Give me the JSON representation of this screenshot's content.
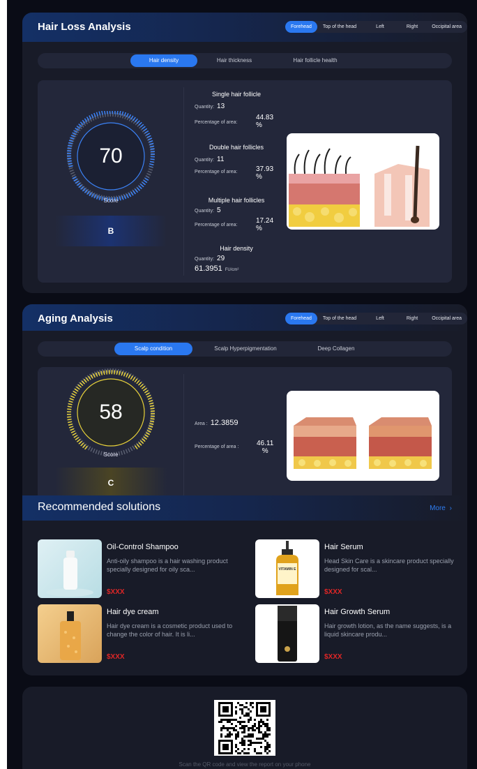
{
  "regions": [
    "Forehead",
    "Top of the head",
    "Left",
    "Right",
    "Occipital area"
  ],
  "hair_loss": {
    "title": "Hair Loss Analysis",
    "tabs": [
      "Hair density",
      "Hair thickness",
      "Hair follicle health"
    ],
    "score": "70",
    "score_label": "Score",
    "grade": "B",
    "quantity_label": "Quantity:",
    "percentage_label": "Percentage of area:",
    "single": {
      "title": "Single hair follicle",
      "quantity": "13",
      "percentage": "44.83",
      "unit": "%"
    },
    "double": {
      "title": "Double hair follicles",
      "quantity": "11",
      "percentage": "37.93",
      "unit": "%"
    },
    "multiple": {
      "title": "Multiple hair follicles",
      "quantity": "5",
      "percentage": "17.24",
      "unit": "%"
    },
    "density": {
      "title": "Hair density",
      "quantity": "29",
      "value": "61.3951",
      "unit": "FU/cm²"
    }
  },
  "aging": {
    "title": "Aging Analysis",
    "tabs": [
      "Scalp condition",
      "Scalp Hyperpigmentation",
      "Deep Collagen"
    ],
    "score": "58",
    "score_label": "Score",
    "grade": "C",
    "area_label": "Area :",
    "area_value": "12.3859",
    "percentage_label": "Percentage of area :",
    "percentage_value": "46.11",
    "percentage_unit": "%"
  },
  "recommended": {
    "title": "Recommended solutions",
    "more": "More",
    "products": [
      {
        "name": "Oil-Control Shampoo",
        "desc": "Anti-oily shampoo is a hair washing product specially designed for oily sca...",
        "price": "$XXX"
      },
      {
        "name": "Hair Serum",
        "desc": "Head Skin Care is a skincare product specially designed for scal...",
        "price": "$XXX"
      },
      {
        "name": "Hair dye cream",
        "desc": "Hair dye cream is a cosmetic product used to change the color of hair. It is li...",
        "price": "$XXX"
      },
      {
        "name": "Hair Growth Serum",
        "desc": "Hair growth lotion, as the name suggests, is a liquid skincare produ...",
        "price": "$XXX"
      }
    ]
  },
  "serum_bottle_label": "VITAMIN E",
  "qr_caption": "Scan the QR code and view the report on your phone",
  "colors": {
    "accent": "#2a78f0",
    "price": "#e02626",
    "gauge_blue": "#3b82f6",
    "gauge_gold": "#e8d23a"
  }
}
